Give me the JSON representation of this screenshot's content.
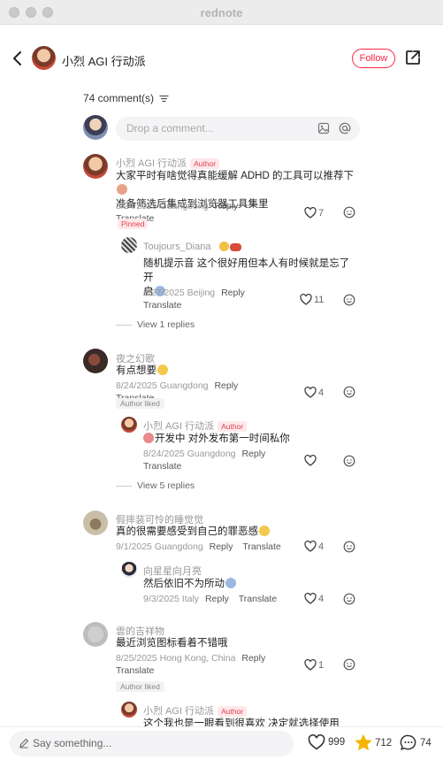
{
  "window": {
    "title": "rednote"
  },
  "header": {
    "author_name": "小烈 AGI 行动派",
    "follow_label": "Follow"
  },
  "comments_section": {
    "count_label": "74 comment(s)",
    "drop_placeholder": "Drop a comment...",
    "author_badge": "Author",
    "pinned_badge": "Pinned",
    "author_liked_badge": "Author liked",
    "reply_label": "Reply",
    "translate_label": "Translate"
  },
  "comments": [
    {
      "name": "小烈 AGI 行动派",
      "text_line1": "大家平时有啥觉得真能缓解 ADHD 的工具可以推荐下",
      "text_line2": "准备筛选后集成到浏览器工具集里",
      "meta": "8/24/2025 Guangdong",
      "likes": "7",
      "reply": {
        "name": "Toujours_Diana",
        "text_line1": "随机提示音 这个很好用但本人有时候就是忘了开",
        "text_line2": "启",
        "meta": "8/27/2025 Beijing",
        "likes": "11"
      },
      "view_replies": "View 1 replies"
    },
    {
      "name": "夜之幻歌",
      "text_line1": "有点想要",
      "meta": "8/24/2025 Guangdong",
      "likes": "4",
      "reply": {
        "name": "小烈 AGI 行动派",
        "text_line1": "开发中 对外发布第一时间私你",
        "meta": "8/24/2025 Guangdong",
        "likes": ""
      },
      "view_replies": "View 5 replies"
    },
    {
      "name": "假摔装可怜的睡觉觉",
      "text_line1": "真的很需要感受到自己的罪恶感",
      "meta": "9/1/2025 Guangdong",
      "likes": "4",
      "reply": {
        "name": "向星星向月亮",
        "text_line1": "然后依旧不为所动",
        "meta": "9/3/2025 Italy",
        "likes": "4"
      }
    },
    {
      "name": "雲的吉祥物",
      "text_line1": "最近浏览图标看着不错哦",
      "meta": "8/25/2025 Hong Kong, China",
      "likes": "1",
      "reply": {
        "name": "小烈 AGI 行动派",
        "text_line1": "这个我也是一眼看到很喜欢 决定就选择使用"
      }
    }
  ],
  "bottom_bar": {
    "say_placeholder": "Say something...",
    "likes_count": "999",
    "stars_count": "712",
    "comments_count": "74"
  },
  "colors": {
    "accent": "#ff2442",
    "star": "#f5b400"
  }
}
